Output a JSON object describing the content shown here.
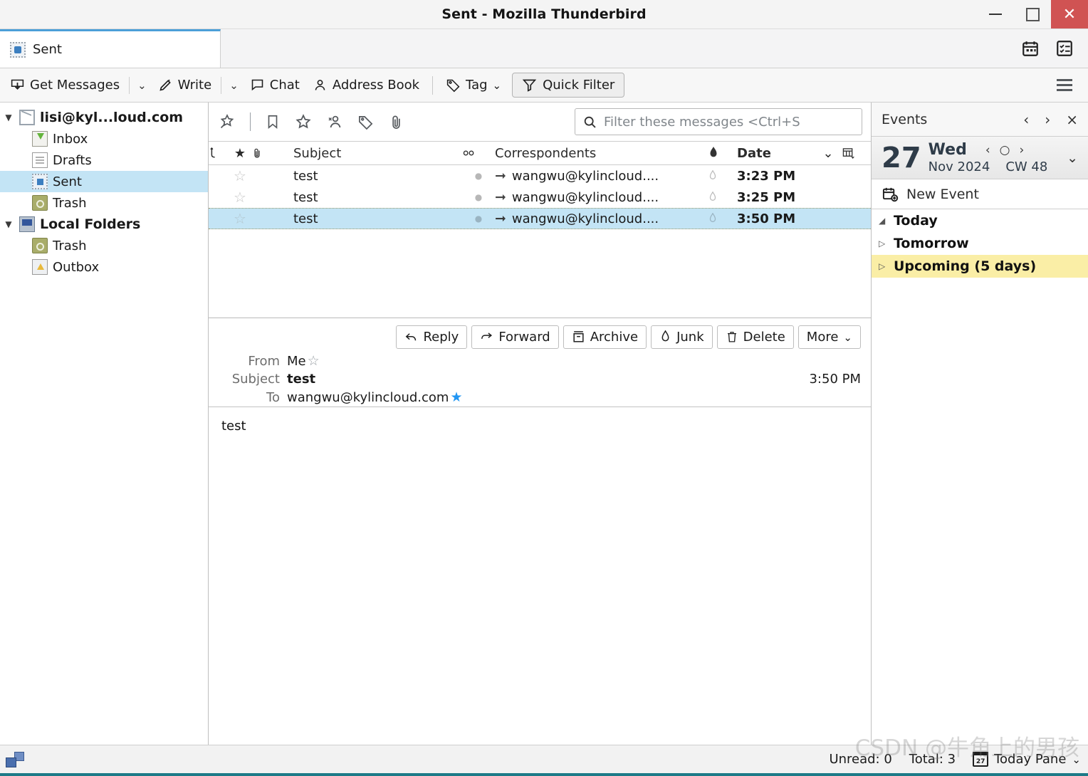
{
  "window": {
    "title": "Sent - Mozilla Thunderbird",
    "minimize_label": "Minimize",
    "maximize_label": "Maximize",
    "close_label": "Close"
  },
  "tabbar": {
    "active_tab": "Sent",
    "icons": [
      "calendar-icon",
      "tasks-icon"
    ]
  },
  "toolbar": {
    "get_messages": "Get Messages",
    "write": "Write",
    "chat": "Chat",
    "address_book": "Address Book",
    "tag": "Tag",
    "quick_filter": "Quick Filter",
    "app_menu": "app-menu"
  },
  "sidebar": {
    "items": [
      {
        "label": "lisi@kyl...loud.com",
        "icon": "envelope-icon",
        "level": 0,
        "twisty": "▼",
        "selected": false,
        "bold": true
      },
      {
        "label": "Inbox",
        "icon": "inbox-icon",
        "level": 1,
        "twisty": "",
        "selected": false,
        "bold": false
      },
      {
        "label": "Drafts",
        "icon": "drafts-icon",
        "level": 1,
        "twisty": "",
        "selected": false,
        "bold": false
      },
      {
        "label": "Sent",
        "icon": "sent-icon",
        "level": 1,
        "twisty": "",
        "selected": true,
        "bold": false
      },
      {
        "label": "Trash",
        "icon": "trash-icon",
        "level": 1,
        "twisty": "",
        "selected": false,
        "bold": false
      },
      {
        "label": "Local Folders",
        "icon": "local-folders-icon",
        "level": 0,
        "twisty": "▼",
        "selected": false,
        "bold": true
      },
      {
        "label": "Trash",
        "icon": "trash-icon",
        "level": 1,
        "twisty": "",
        "selected": false,
        "bold": false
      },
      {
        "label": "Outbox",
        "icon": "outbox-icon",
        "level": 1,
        "twisty": "",
        "selected": false,
        "bold": false
      }
    ]
  },
  "quickfilter_bar": {
    "icons": [
      "unread-pin-icon",
      "starred-bookmark-icon",
      "star-icon",
      "contact-icon",
      "tag-icon",
      "attachment-icon"
    ],
    "search": {
      "placeholder": "Filter these messages <Ctrl+S",
      "value": ""
    }
  },
  "messagelist": {
    "columns": {
      "thread": "thread-column-icon",
      "star": "star-column-icon",
      "attachment": "attachment-column-icon",
      "subject": "Subject",
      "unread": "unread-column-icon",
      "correspondents": "Correspondents",
      "junk": "junk-column-icon",
      "date": "Date",
      "sort_indicator": "⌄",
      "column_picker": "column-picker-icon"
    },
    "rows": [
      {
        "subject": "test",
        "correspondent": "wangwu@kylincloud....",
        "date": "3:23 PM",
        "selected": false,
        "direction": "outgoing"
      },
      {
        "subject": "test",
        "correspondent": "wangwu@kylincloud....",
        "date": "3:25 PM",
        "selected": false,
        "direction": "outgoing"
      },
      {
        "subject": "test",
        "correspondent": "wangwu@kylincloud....",
        "date": "3:50 PM",
        "selected": true,
        "direction": "outgoing"
      }
    ]
  },
  "reader": {
    "actions": [
      {
        "label": "Reply",
        "icon": "reply-icon"
      },
      {
        "label": "Forward",
        "icon": "forward-icon"
      },
      {
        "label": "Archive",
        "icon": "archive-icon"
      },
      {
        "label": "Junk",
        "icon": "junk-icon"
      },
      {
        "label": "Delete",
        "icon": "trash-icon"
      },
      {
        "label": "More",
        "icon": "chevron-down-icon"
      }
    ],
    "from_label": "From",
    "from_value": "Me",
    "subject_label": "Subject",
    "subject_value": "test",
    "time": "3:50 PM",
    "to_label": "To",
    "to_value": "wangwu@kylincloud.com",
    "body": "test"
  },
  "todaypane": {
    "title": "Events",
    "nav_prev": "‹",
    "nav_next": "›",
    "close": "×",
    "day_number": "27",
    "day_of_week": "Wed",
    "month_year": "Nov 2024",
    "calendar_week": "CW 48",
    "mini_prev": "‹",
    "mini_today": "○",
    "mini_next": "›",
    "expand": "⌄",
    "new_event": "New Event",
    "sections": [
      {
        "label": "Today",
        "twisty": "◢",
        "highlight": false
      },
      {
        "label": "Tomorrow",
        "twisty": "▷",
        "highlight": false
      },
      {
        "label": "Upcoming (5 days)",
        "twisty": "▷",
        "highlight": true
      }
    ]
  },
  "statusbar": {
    "network_icon": "network-status-icon",
    "unread": "Unread: 0",
    "total": "Total: 3",
    "today_pane": "Today Pane",
    "today_pane_chevron": "⌄"
  },
  "watermark": "CSDN @牛角上的男孩",
  "colors": {
    "selection": "#c3e4f5",
    "accent_blue": "#4b9fd8",
    "close_red": "#d05353",
    "highlight_yellow": "#faeea6",
    "bottom_border": "#1d7a87"
  }
}
